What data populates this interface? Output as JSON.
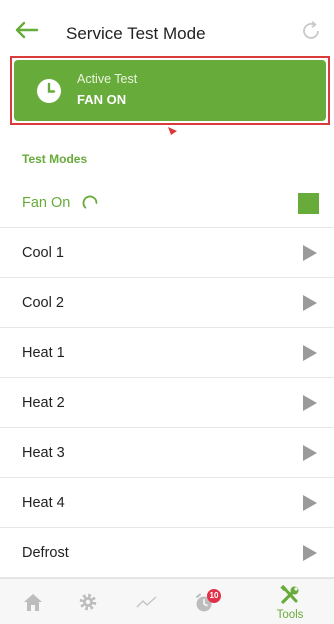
{
  "header": {
    "title": "Service Test Mode",
    "back_icon": "arrow-left-icon",
    "refresh_icon": "refresh-icon"
  },
  "active_test": {
    "label": "Active Test",
    "value": "FAN ON",
    "icon": "clock-icon"
  },
  "test_modes": {
    "section_title": "Test Modes",
    "running": {
      "label": "Fan On",
      "status_icon": "spinner-icon",
      "action_icon": "stop-icon"
    },
    "items": [
      {
        "label": "Cool 1"
      },
      {
        "label": "Cool 2"
      },
      {
        "label": "Heat 1"
      },
      {
        "label": "Heat 2"
      },
      {
        "label": "Heat 3"
      },
      {
        "label": "Heat 4"
      },
      {
        "label": "Defrost"
      }
    ]
  },
  "bottom_nav": {
    "alerts_badge": "10",
    "tools_label": "Tools"
  },
  "colors": {
    "accent": "#67ab3a",
    "highlight_border": "#d93a3a",
    "badge": "#e2324a",
    "inactive_icon": "#bdbdbd"
  }
}
